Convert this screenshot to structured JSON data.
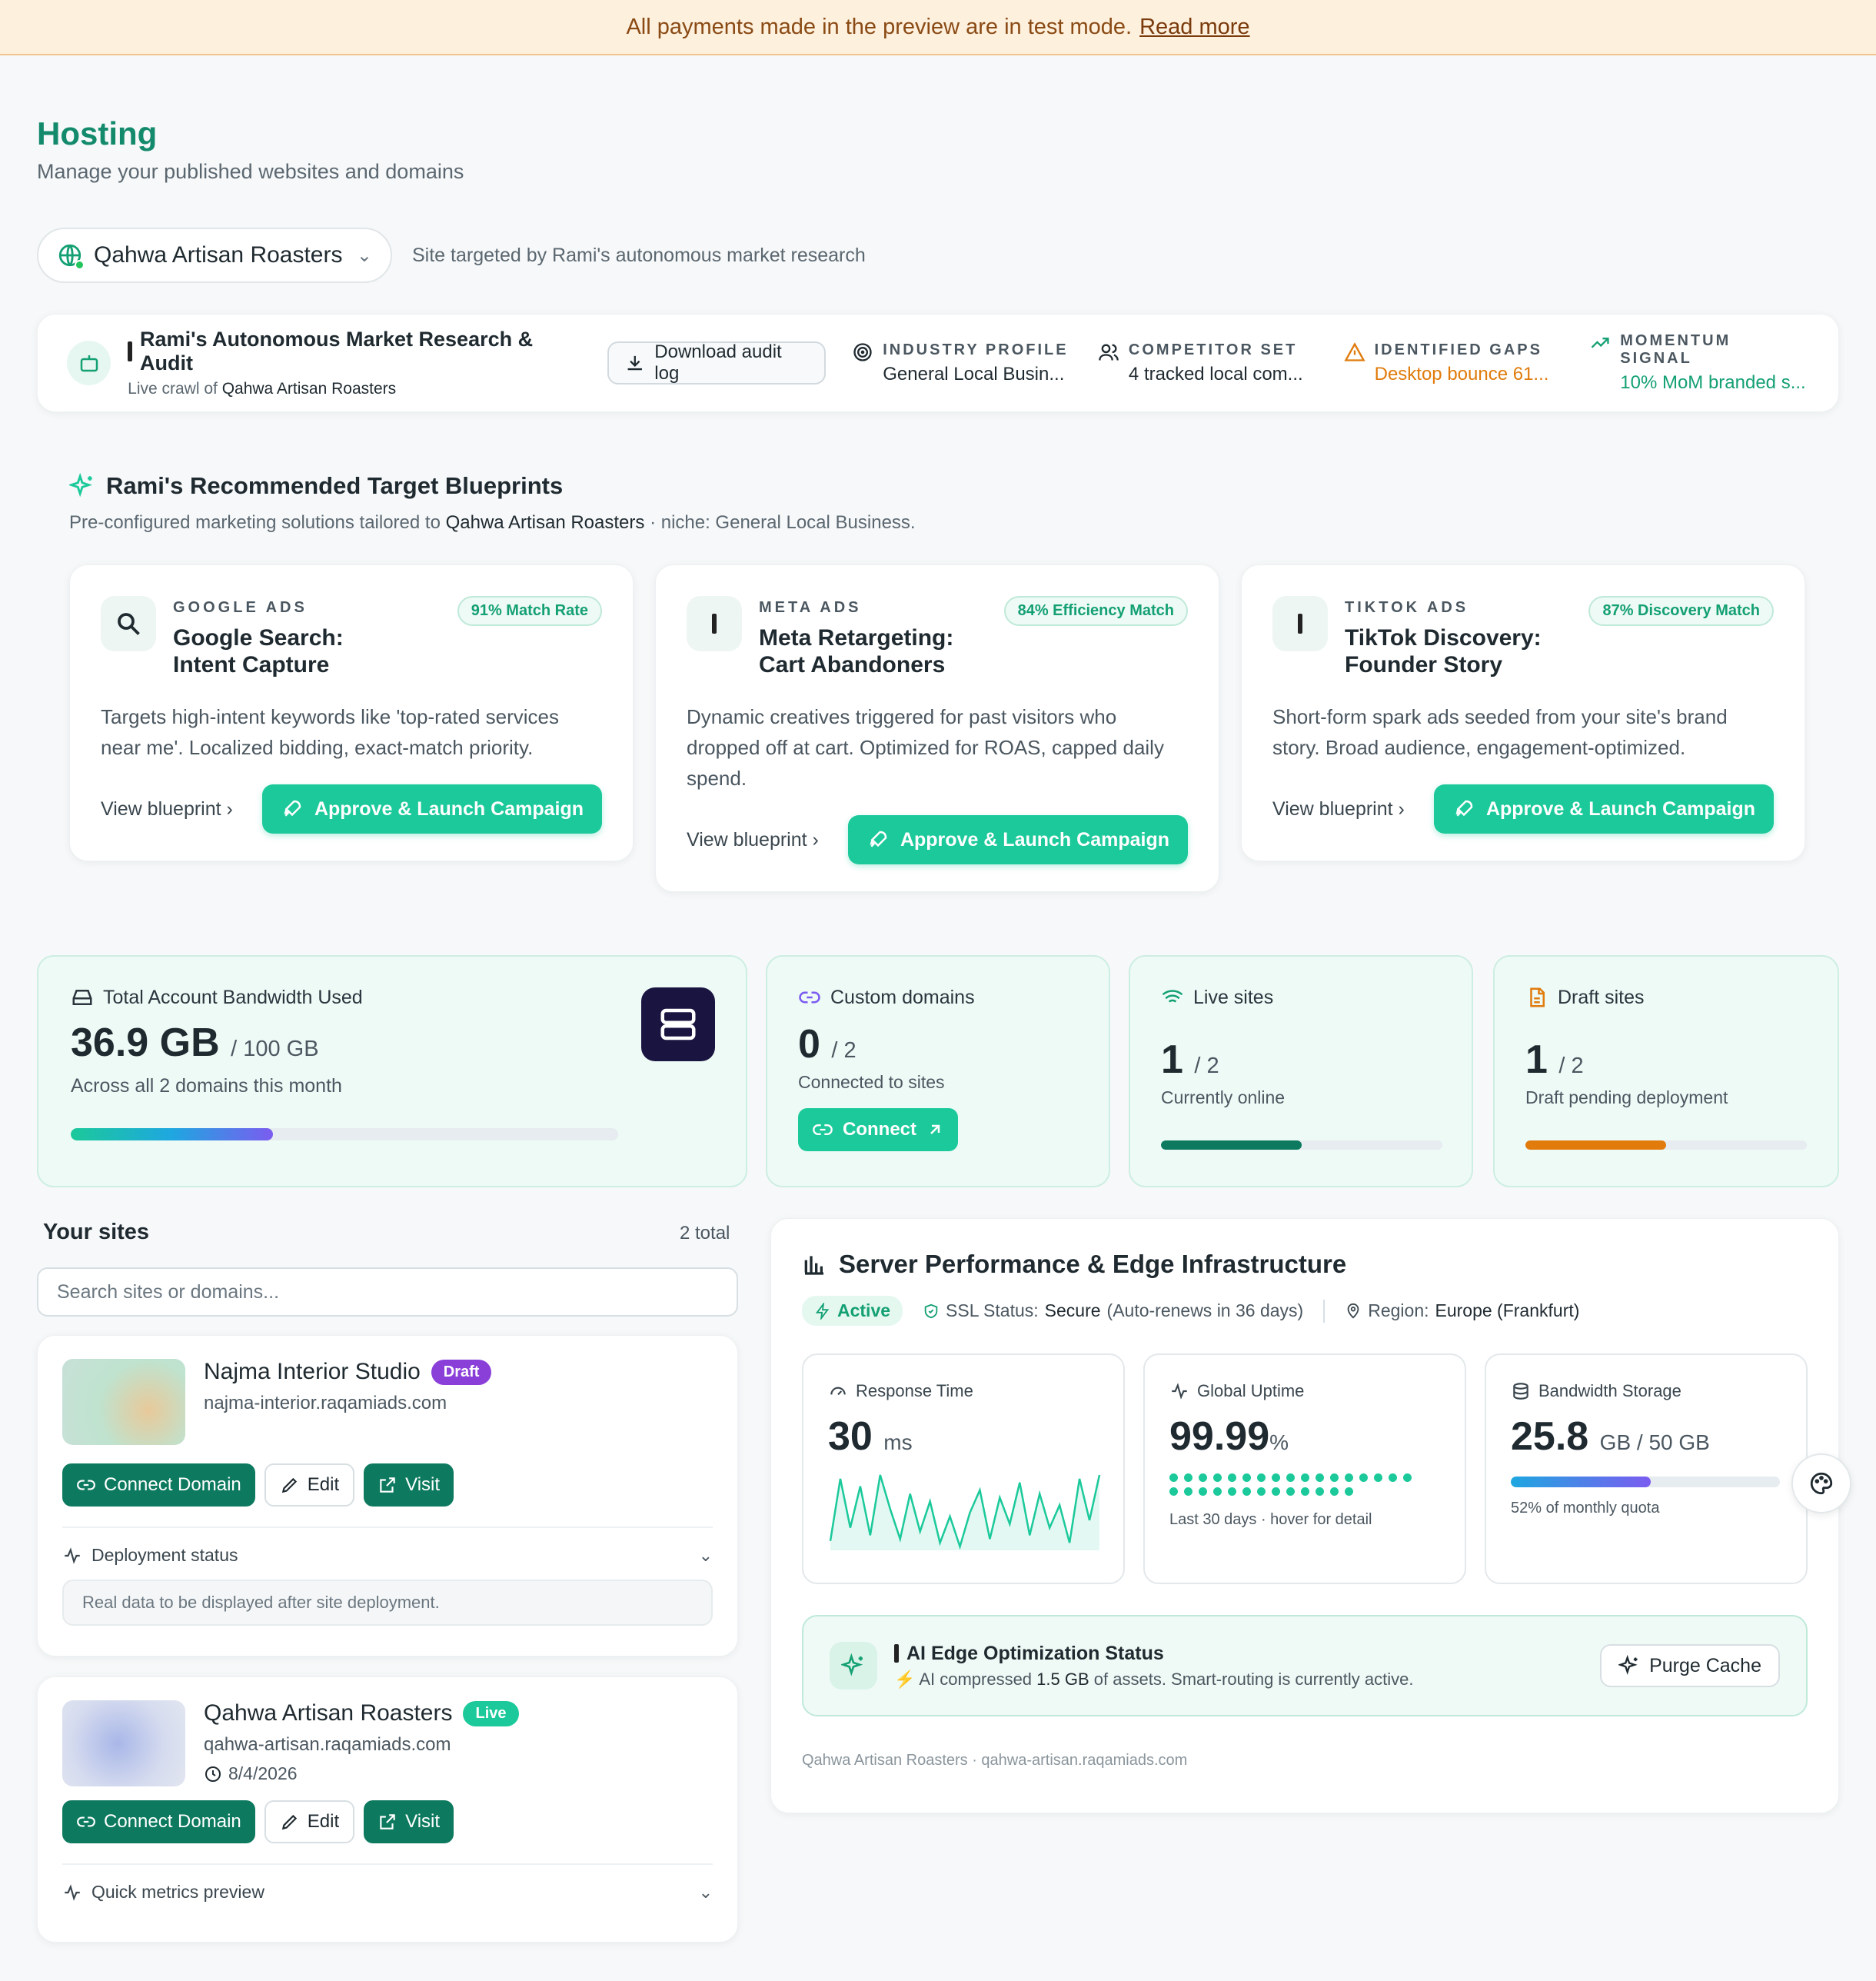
{
  "banner": {
    "text": "All payments made in the preview are in test mode.",
    "link": "Read more"
  },
  "page": {
    "title": "Hosting",
    "subtitle": "Manage your published websites and domains"
  },
  "site_selector": {
    "value": "Qahwa Artisan Roasters",
    "note": "Site targeted by Rami's autonomous market research"
  },
  "audit": {
    "title": "Rami's Autonomous Market Research & Audit",
    "sub_prefix": "Live crawl of",
    "sub_site": "Qahwa Artisan Roasters",
    "download": "Download audit log",
    "metrics": [
      {
        "key": "INDUSTRY PROFILE",
        "value": "General Local Busin..."
      },
      {
        "key": "COMPETITOR SET",
        "value": "4 tracked local com..."
      },
      {
        "key": "IDENTIFIED GAPS",
        "value": "Desktop bounce 61..."
      },
      {
        "key": "MOMENTUM SIGNAL",
        "value": "10% MoM branded s..."
      }
    ]
  },
  "blueprints": {
    "title": "Rami's Recommended Target Blueprints",
    "sub_prefix": "Pre-configured marketing solutions tailored to",
    "sub_site": "Qahwa Artisan Roasters",
    "sub_suffix": "· niche: General Local Business.",
    "items": [
      {
        "category": "GOOGLE ADS",
        "name": "Google Search: Intent Capture",
        "badge": "91% Match Rate",
        "desc": "Targets high-intent keywords like 'top-rated services near me'. Localized bidding, exact-match priority.",
        "view": "View blueprint",
        "cta": "Approve & Launch Campaign"
      },
      {
        "category": "META ADS",
        "name": "Meta Retargeting: Cart Abandoners",
        "badge": "84% Efficiency Match",
        "desc": "Dynamic creatives triggered for past visitors who dropped off at cart. Optimized for ROAS, capped daily spend.",
        "view": "View blueprint",
        "cta": "Approve & Launch Campaign"
      },
      {
        "category": "TIKTOK ADS",
        "name": "TikTok Discovery: Founder Story",
        "badge": "87% Discovery Match",
        "desc": "Short-form spark ads seeded from your site's brand story. Broad audience, engagement-optimized.",
        "view": "View blueprint",
        "cta": "Approve & Launch Campaign"
      }
    ]
  },
  "stats": {
    "bandwidth": {
      "label": "Total Account Bandwidth Used",
      "value": "36.9 GB",
      "total": "/ 100 GB",
      "note": "Across all 2 domains this month",
      "fraction": 0.369
    },
    "domains": {
      "label": "Custom domains",
      "value": "0",
      "total": "/ 2",
      "note": "Connected to sites",
      "button": "Connect"
    },
    "live": {
      "label": "Live sites",
      "value": "1",
      "total": "/ 2",
      "note": "Currently online",
      "fraction": 0.5
    },
    "draft": {
      "label": "Draft sites",
      "value": "1",
      "total": "/ 2",
      "note": "Draft pending deployment",
      "fraction": 0.5
    }
  },
  "sites": {
    "title": "Your sites",
    "count": "2 total",
    "search_placeholder": "Search sites or domains...",
    "items": [
      {
        "name": "Najma Interior Studio",
        "status": "Draft",
        "domain": "najma-interior.raqamiads.com",
        "connect": "Connect Domain",
        "edit": "Edit",
        "visit": "Visit",
        "collapse": "Deployment status",
        "note": "Real data to be displayed after site deployment."
      },
      {
        "name": "Qahwa Artisan Roasters",
        "status": "Live",
        "domain": "qahwa-artisan.raqamiads.com",
        "date": "8/4/2026",
        "connect": "Connect Domain",
        "edit": "Edit",
        "visit": "Visit",
        "collapse": "Quick metrics preview"
      }
    ]
  },
  "perf": {
    "title": "Server Performance & Edge Infrastructure",
    "active": "Active",
    "ssl_label": "SSL Status:",
    "ssl_value": "Secure",
    "ssl_note": "(Auto-renews in 36 days)",
    "region_label": "Region:",
    "region_value": "Europe (Frankfurt)",
    "response": {
      "label": "Response Time",
      "value": "30",
      "unit": "ms",
      "spark": [
        5,
        38,
        12,
        34,
        8,
        40,
        22,
        6,
        30,
        10,
        26,
        4,
        18,
        2,
        20,
        32,
        6,
        28,
        14,
        36,
        8,
        30,
        12,
        24,
        4,
        38,
        16,
        40
      ]
    },
    "uptime": {
      "label": "Global Uptime",
      "value": "99.99",
      "unit": "%",
      "note": "Last 30 days · hover for detail",
      "days": 30
    },
    "storage": {
      "label": "Bandwidth Storage",
      "value": "25.8",
      "unit": "GB / 50 GB",
      "note": "52% of monthly quota",
      "fraction": 0.52
    },
    "ai": {
      "title": "AI Edge Optimization Status",
      "sub_prefix": "AI compressed",
      "sub_amount": "1.5 GB",
      "sub_suffix": "of assets. Smart-routing is currently active.",
      "purge": "Purge Cache"
    },
    "footer": "Qahwa Artisan Roasters · qahwa-artisan.raqamiads.com"
  },
  "colors": {
    "accent": "#1bc99a",
    "dark_accent": "#0d7a5f",
    "draft": "#8b3fd9",
    "live": "#1bc99a",
    "orange": "#e07b0c"
  }
}
